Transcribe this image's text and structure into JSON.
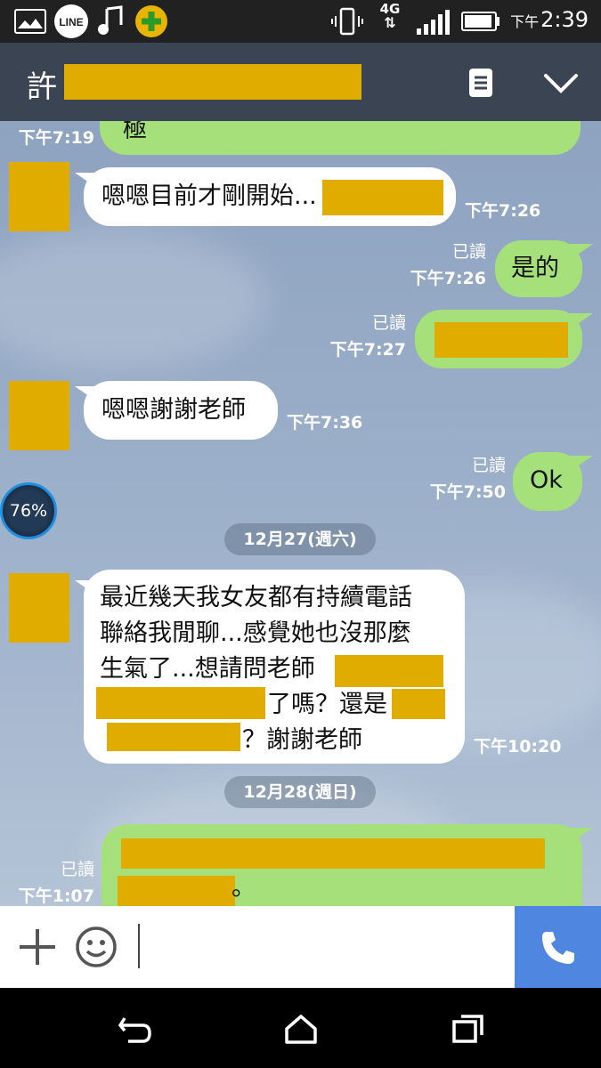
{
  "status_bar": {
    "left_icons": [
      "gallery-icon",
      "line-app-icon",
      "music-note-icon",
      "green-plus-app-icon"
    ],
    "line_label": "LINE",
    "network": "4G",
    "time_prefix": "下午",
    "time": "2:39"
  },
  "header": {
    "contact_name": "許",
    "notes_icon": "note-icon",
    "collapse_icon": "chevron-down-icon"
  },
  "messages": [
    {
      "direction": "out",
      "text": "極",
      "time": "下午7:19",
      "read": ""
    },
    {
      "direction": "in",
      "text": "嗯嗯目前才剛開始...",
      "time": "下午7:26"
    },
    {
      "direction": "out",
      "text": "是的",
      "time": "下午7:26",
      "read": "已讀"
    },
    {
      "direction": "out",
      "text": "",
      "time": "下午7:27",
      "read": "已讀"
    },
    {
      "direction": "in",
      "text": "嗯嗯謝謝老師",
      "time": "下午7:36"
    },
    {
      "direction": "out",
      "text": "Ok",
      "time": "下午7:50",
      "read": "已讀"
    },
    {
      "direction": "in",
      "lines": [
        "最近幾天我女友都有持續電話",
        "聯絡我閒聊...感覺她也沒那麼",
        "生氣了...想請問老師",
        "了嗎？還是",
        "？謝謝老師"
      ],
      "time": "下午10:20"
    },
    {
      "direction": "out",
      "lines": [
        "",
        "。"
      ],
      "time": "下午1:07",
      "read": "已讀"
    }
  ],
  "date_separators": [
    "12月27(週六)",
    "12月28(週日)"
  ],
  "floating_badge": "76%",
  "input_bar": {
    "plus_icon": "plus-icon",
    "emoji_icon": "emoji-icon",
    "call_icon": "phone-icon"
  },
  "nav_bar": [
    "back-icon",
    "home-icon",
    "recents-icon"
  ],
  "colors": {
    "header_bg": "#3b4452",
    "out_bubble": "#a6e07a",
    "in_bubble": "#ffffff",
    "call_button": "#4f86e0",
    "redaction": "#e0ac00"
  }
}
